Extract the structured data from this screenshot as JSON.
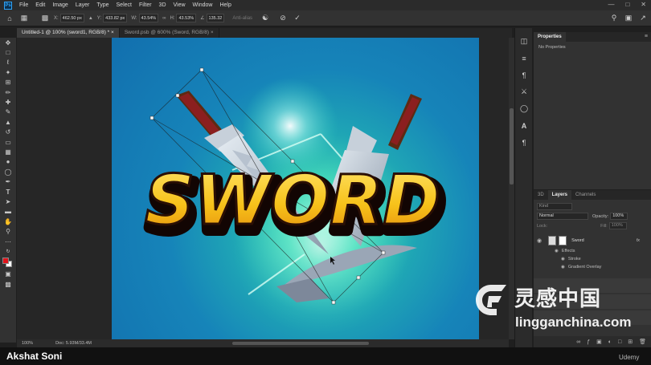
{
  "app": {
    "logo_text": "Ps"
  },
  "menu": [
    "File",
    "Edit",
    "Image",
    "Layer",
    "Type",
    "Select",
    "Filter",
    "3D",
    "View",
    "Window",
    "Help"
  ],
  "options": {
    "x_label": "X:",
    "x_value": "462.50 px",
    "y_label": "Y:",
    "y_value": "433.82 px",
    "w_label": "W:",
    "w_value": "43.54%",
    "h_label": "H:",
    "h_value": "43.53%",
    "angle_value": "135.32",
    "antialias_label": "Anti-alias"
  },
  "tabs": [
    {
      "label": "Untitled-1 @ 100% (sword1, RGB/8) *",
      "close": "×",
      "active": true
    },
    {
      "label": "Sword.psb @ 600% (Sword, RGB/8)",
      "close": "×",
      "active": false
    }
  ],
  "status": {
    "zoom": "100%",
    "doc": "Doc: 5.93M/33.4M"
  },
  "properties": {
    "tab_label": "Properties",
    "content": "No Properties"
  },
  "layers_panel": {
    "tabs": [
      "3D",
      "Layers",
      "Channels"
    ],
    "search_placeholder": "Kind",
    "blend_mode": "Normal",
    "opacity_label": "Opacity:",
    "opacity_value": "100%",
    "lock_label": "Lock:",
    "fill_label": "Fill:",
    "fill_value": "100%",
    "layer_name": "Sword",
    "effects_label": "Effects",
    "effect_1": "Stroke",
    "effect_2": "Gradient Overlay",
    "fx": "fx"
  },
  "artwork": {
    "title_text": "SWORD"
  },
  "presenter": "Akshat Soni",
  "brand": "Udemy",
  "watermark": {
    "cn": "灵感中国",
    "url": "lingganchina.com"
  },
  "colors": {
    "accent_blue": "#2fa3f7",
    "foreground": "#e0141b",
    "background": "#ffffff",
    "title_yellow": "#f7c21a"
  }
}
